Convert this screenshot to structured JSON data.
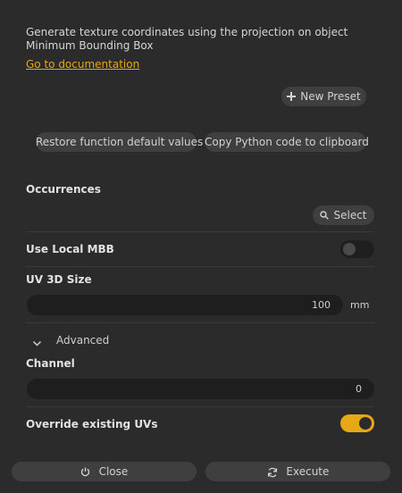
{
  "description": "Generate texture coordinates using the projection on object Minimum Bounding Box",
  "doc_link": "Go to documentation",
  "buttons": {
    "new_preset": "New Preset",
    "restore_defaults": "Restore function default values",
    "copy_python": "Copy Python code to clipboard",
    "select": "Select",
    "close": "Close",
    "execute": "Execute"
  },
  "occurrences_label": "Occurrences",
  "use_local_mbb": {
    "label": "Use Local MBB",
    "enabled": false
  },
  "uv3d_size": {
    "label": "UV 3D Size",
    "value": "100",
    "unit": "mm"
  },
  "advanced_label": "Advanced",
  "channel": {
    "label": "Channel",
    "value": "0"
  },
  "override_uvs": {
    "label": "Override existing UVs",
    "enabled": true
  },
  "colors": {
    "accent": "#e6a817",
    "background": "#2b2b2b",
    "field": "#1e1e1e",
    "button": "#3f3f3f"
  },
  "icons": [
    "plus-icon",
    "search-icon",
    "chevron-down-icon",
    "power-icon",
    "refresh-icon"
  ]
}
